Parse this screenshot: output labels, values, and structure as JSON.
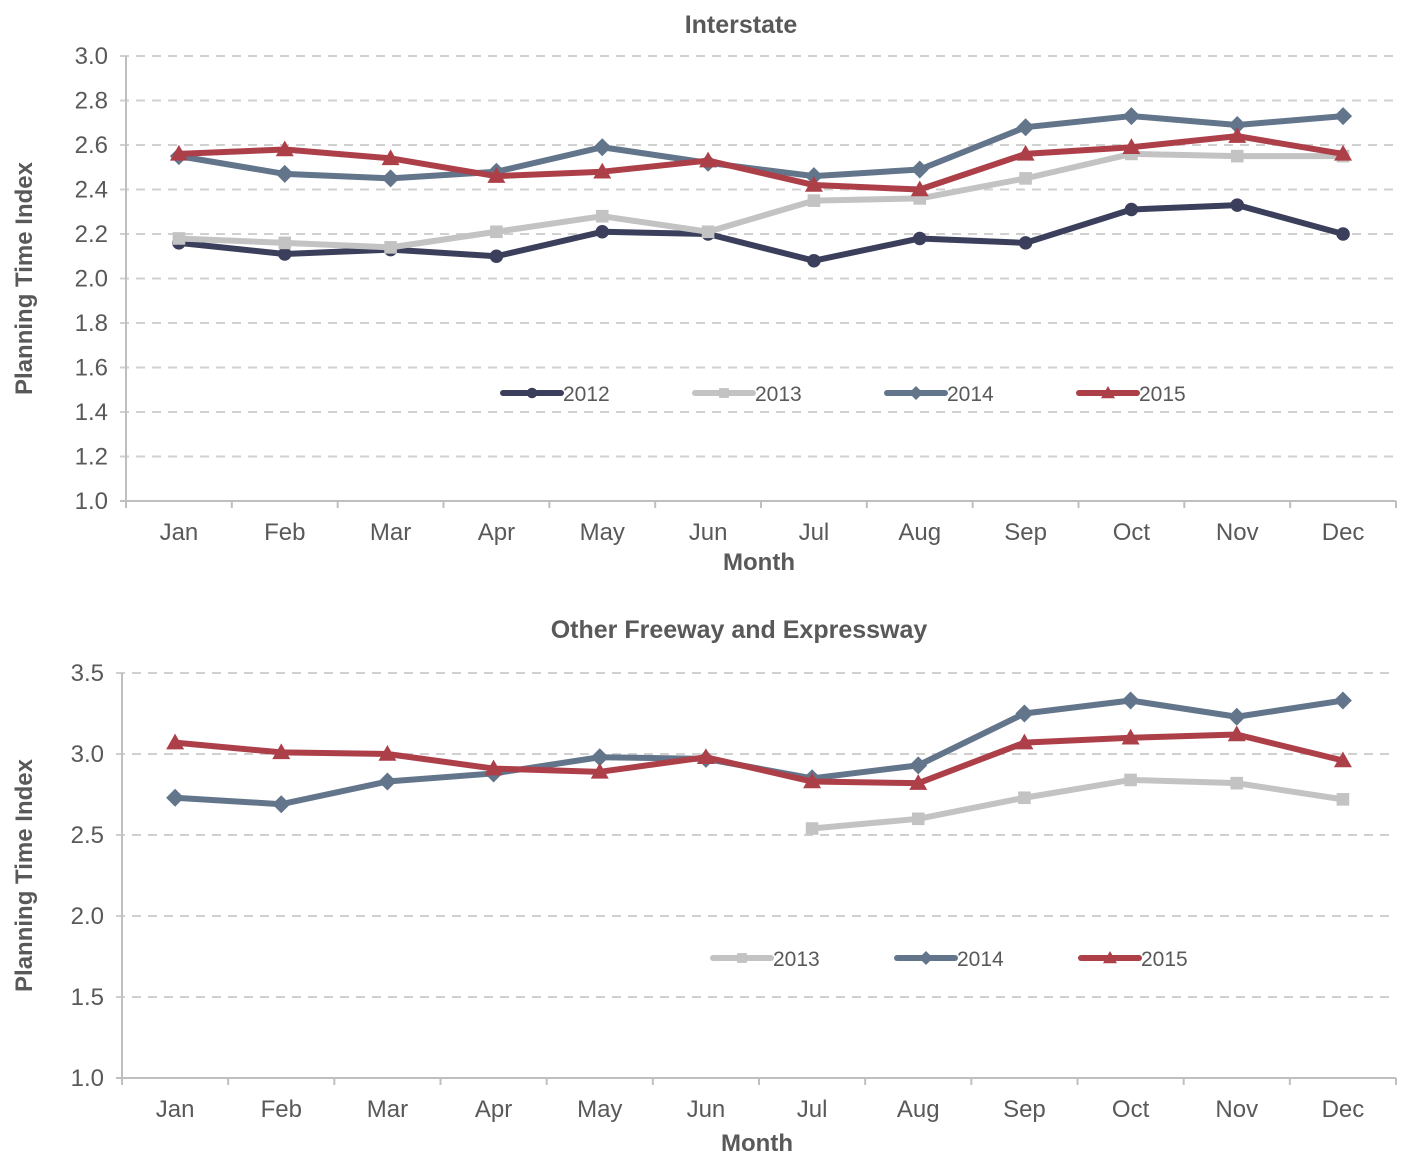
{
  "chart_data": [
    {
      "type": "line",
      "title": "Interstate",
      "xlabel": "Month",
      "ylabel": "Planning Time Index",
      "categories": [
        "Jan",
        "Feb",
        "Mar",
        "Apr",
        "May",
        "Jun",
        "Jul",
        "Aug",
        "Sep",
        "Oct",
        "Nov",
        "Dec"
      ],
      "ylim": [
        1.0,
        3.0
      ],
      "yticks": [
        "1.0",
        "1.2",
        "1.4",
        "1.6",
        "1.8",
        "2.0",
        "2.2",
        "2.4",
        "2.6",
        "2.8",
        "3.0"
      ],
      "grid": true,
      "legend_position": "lower-center",
      "series": [
        {
          "name": "2012",
          "color": "#3b3f5c",
          "marker": "circle",
          "values": [
            2.16,
            2.11,
            2.13,
            2.1,
            2.21,
            2.2,
            2.08,
            2.18,
            2.16,
            2.31,
            2.33,
            2.2
          ]
        },
        {
          "name": "2013",
          "color": "#c3c3c3",
          "marker": "square",
          "values": [
            2.18,
            2.16,
            2.14,
            2.21,
            2.28,
            2.21,
            2.35,
            2.36,
            2.45,
            2.56,
            2.55,
            2.55
          ]
        },
        {
          "name": "2014",
          "color": "#62758b",
          "marker": "diamond",
          "values": [
            2.55,
            2.47,
            2.45,
            2.48,
            2.59,
            2.52,
            2.46,
            2.49,
            2.68,
            2.73,
            2.69,
            2.73
          ]
        },
        {
          "name": "2015",
          "color": "#ad3f49",
          "marker": "triangle",
          "values": [
            2.56,
            2.58,
            2.54,
            2.46,
            2.48,
            2.53,
            2.42,
            2.4,
            2.56,
            2.59,
            2.64,
            2.56
          ]
        }
      ]
    },
    {
      "type": "line",
      "title": "Other Freeway and Expressway",
      "xlabel": "Month",
      "ylabel": "Planning Time Index",
      "categories": [
        "Jan",
        "Feb",
        "Mar",
        "Apr",
        "May",
        "Jun",
        "Jul",
        "Aug",
        "Sep",
        "Oct",
        "Nov",
        "Dec"
      ],
      "ylim": [
        1.0,
        3.5
      ],
      "yticks": [
        "1.0",
        "1.5",
        "2.0",
        "2.5",
        "3.0",
        "3.5"
      ],
      "grid": true,
      "legend_position": "lower-center",
      "series": [
        {
          "name": "2013",
          "color": "#c3c3c3",
          "marker": "square",
          "values": [
            null,
            null,
            null,
            null,
            null,
            null,
            2.54,
            2.6,
            2.73,
            2.84,
            2.82,
            2.72
          ]
        },
        {
          "name": "2014",
          "color": "#62758b",
          "marker": "diamond",
          "values": [
            2.73,
            2.69,
            2.83,
            2.88,
            2.98,
            2.97,
            2.85,
            2.93,
            3.25,
            3.33,
            3.23,
            3.33
          ]
        },
        {
          "name": "2015",
          "color": "#ad3f49",
          "marker": "triangle",
          "values": [
            3.07,
            3.01,
            3.0,
            2.91,
            2.89,
            2.98,
            2.83,
            2.82,
            3.07,
            3.1,
            3.12,
            2.96
          ]
        }
      ]
    }
  ]
}
